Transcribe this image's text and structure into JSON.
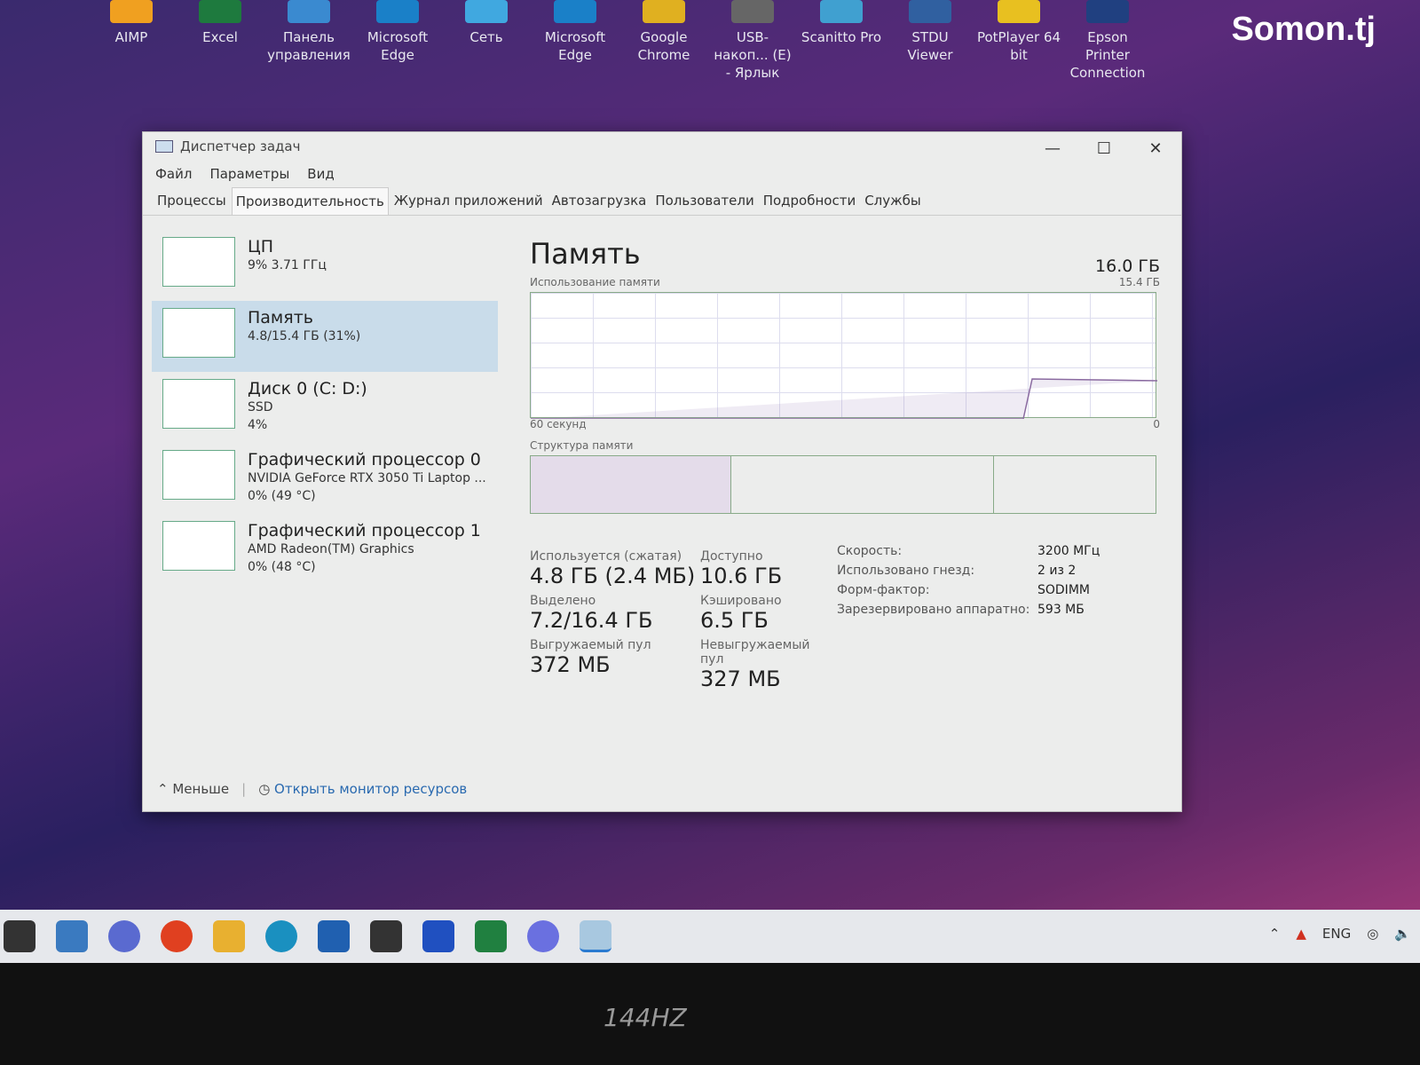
{
  "desktop": {
    "icons": [
      {
        "label": "AIMP",
        "color": "#f0a020"
      },
      {
        "label": "Excel",
        "color": "#1e7a3e"
      },
      {
        "label": "Панель управления",
        "color": "#3a8ad0"
      },
      {
        "label": "Microsoft Edge",
        "color": "#1a80c8"
      },
      {
        "label": "Сеть",
        "color": "#40a8e0"
      },
      {
        "label": "Microsoft Edge",
        "color": "#1a80c8"
      },
      {
        "label": "Google Chrome",
        "color": "#e0b020"
      },
      {
        "label": "USB-накоп... (E) - Ярлык",
        "color": "#666"
      },
      {
        "label": "Scanitto Pro",
        "color": "#40a0d0"
      },
      {
        "label": "STDU Viewer",
        "color": "#3060a0"
      },
      {
        "label": "PotPlayer 64 bit",
        "color": "#e8c020"
      },
      {
        "label": "Epson Printer Connection",
        "color": "#204080"
      }
    ],
    "brand": "Somon.tj"
  },
  "window": {
    "title": "Диспетчер задач",
    "controls": {
      "minimize": "—",
      "maximize": "☐",
      "close": "✕"
    },
    "menu": [
      "Файл",
      "Параметры",
      "Вид"
    ],
    "tabs": [
      "Процессы",
      "Производительность",
      "Журнал приложений",
      "Автозагрузка",
      "Пользователи",
      "Подробности",
      "Службы"
    ],
    "active_tab": "Производительность",
    "sidebar": [
      {
        "name": "ЦП",
        "sub1": "9% 3.71 ГГц",
        "sub2": ""
      },
      {
        "name": "Память",
        "sub1": "4.8/15.4 ГБ (31%)",
        "sub2": ""
      },
      {
        "name": "Диск 0 (C: D:)",
        "sub1": "SSD",
        "sub2": "4%"
      },
      {
        "name": "Графический процессор 0",
        "sub1": "NVIDIA GeForce RTX 3050 Ti Laptop ...",
        "sub2": "0% (49 °C)"
      },
      {
        "name": "Графический процессор 1",
        "sub1": "AMD Radeon(TM) Graphics",
        "sub2": "0% (48 °C)"
      }
    ],
    "selected": "Память",
    "main": {
      "title": "Память",
      "total": "16.0 ГБ",
      "usage_label": "Использование памяти",
      "usage_max": "15.4 ГБ",
      "time_label": "60 секунд",
      "zero": "0",
      "structure_label": "Структура памяти",
      "stats": [
        {
          "label": "Используется (сжатая)",
          "value": "4.8 ГБ (2.4 МБ)"
        },
        {
          "label": "Доступно",
          "value": "10.6 ГБ"
        },
        {
          "label": "Выделено",
          "value": "7.2/16.4 ГБ"
        },
        {
          "label": "Кэшировано",
          "value": "6.5 ГБ"
        },
        {
          "label": "Выгружаемый пул",
          "value": "372 МБ"
        },
        {
          "label": "Невыгружаемый пул",
          "value": "327 МБ"
        }
      ],
      "props": [
        {
          "k": "Скорость:",
          "v": "3200 МГц"
        },
        {
          "k": "Использовано гнезд:",
          "v": "2 из 2"
        },
        {
          "k": "Форм-фактор:",
          "v": "SODIMM"
        },
        {
          "k": "Зарезервировано аппаратно:",
          "v": "593 МБ"
        }
      ]
    },
    "footer": {
      "less": "Меньше",
      "monitor": "Открыть монитор ресурсов"
    }
  },
  "taskbar": {
    "tray": {
      "lang": "ENG"
    }
  },
  "bezel": {
    "refresh": "144HZ"
  }
}
